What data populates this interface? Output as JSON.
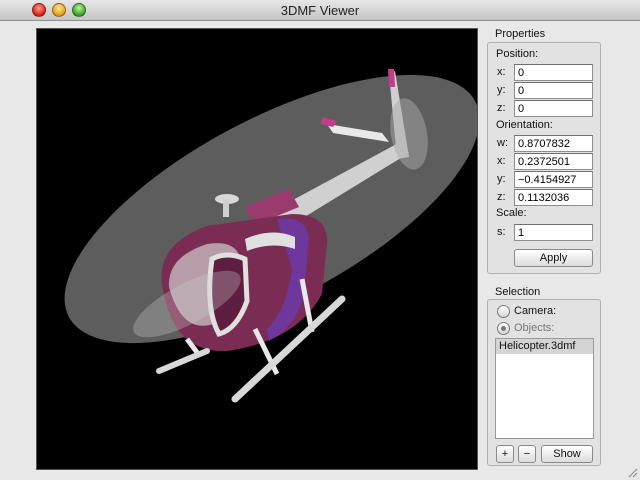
{
  "window": {
    "title": "3DMF Viewer"
  },
  "properties": {
    "title": "Properties",
    "position": {
      "label": "Position:",
      "x": {
        "label": "x:",
        "value": "0"
      },
      "y": {
        "label": "y:",
        "value": "0"
      },
      "z": {
        "label": "z:",
        "value": "0"
      }
    },
    "orientation": {
      "label": "Orientation:",
      "w": {
        "label": "w:",
        "value": "0.8707832"
      },
      "x": {
        "label": "x:",
        "value": "0.2372501"
      },
      "y": {
        "label": "y:",
        "value": "−0.4154927"
      },
      "z": {
        "label": "z:",
        "value": "0.1132036"
      }
    },
    "scale": {
      "label": "Scale:",
      "s": {
        "label": "s:",
        "value": "1"
      }
    },
    "apply_label": "Apply"
  },
  "selection": {
    "title": "Selection",
    "camera_label": "Camera:",
    "objects_label": "Objects:",
    "selected_mode": "objects",
    "items": [
      "Helicopter.3dmf"
    ],
    "add_label": "+",
    "remove_label": "−",
    "show_label": "Show"
  },
  "colors": {
    "viewport_bg": "#000000",
    "model_body": "#7a2c52",
    "model_accent": "#c43b8c",
    "model_stripe": "#6b3aa8",
    "rotor_disc": "#bdbdbd"
  }
}
